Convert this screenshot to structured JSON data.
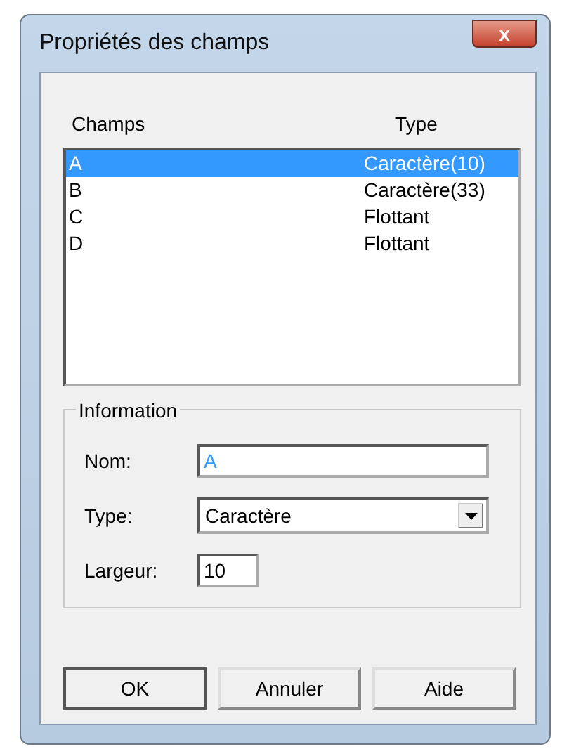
{
  "window": {
    "title": "Propriétés des champs",
    "close": "x"
  },
  "list": {
    "columns": [
      "Champs",
      "Type"
    ],
    "rows": [
      {
        "name": "A",
        "type": "Caractère(10)",
        "selected": true
      },
      {
        "name": "B",
        "type": "Caractère(33)",
        "selected": false
      },
      {
        "name": "C",
        "type": "Flottant",
        "selected": false
      },
      {
        "name": "D",
        "type": "Flottant",
        "selected": false
      }
    ]
  },
  "information": {
    "legend": "Information",
    "fields": [
      {
        "kind": "text",
        "label": "Nom:",
        "value": "A",
        "selected": true
      },
      {
        "kind": "select",
        "label": "Type:",
        "value": "Caractère"
      },
      {
        "kind": "short",
        "label": "Largeur:",
        "value": "10"
      }
    ]
  },
  "buttons": [
    {
      "label": "OK",
      "default": true
    },
    {
      "label": "Annuler",
      "default": false
    },
    {
      "label": "Aide",
      "default": false
    }
  ]
}
